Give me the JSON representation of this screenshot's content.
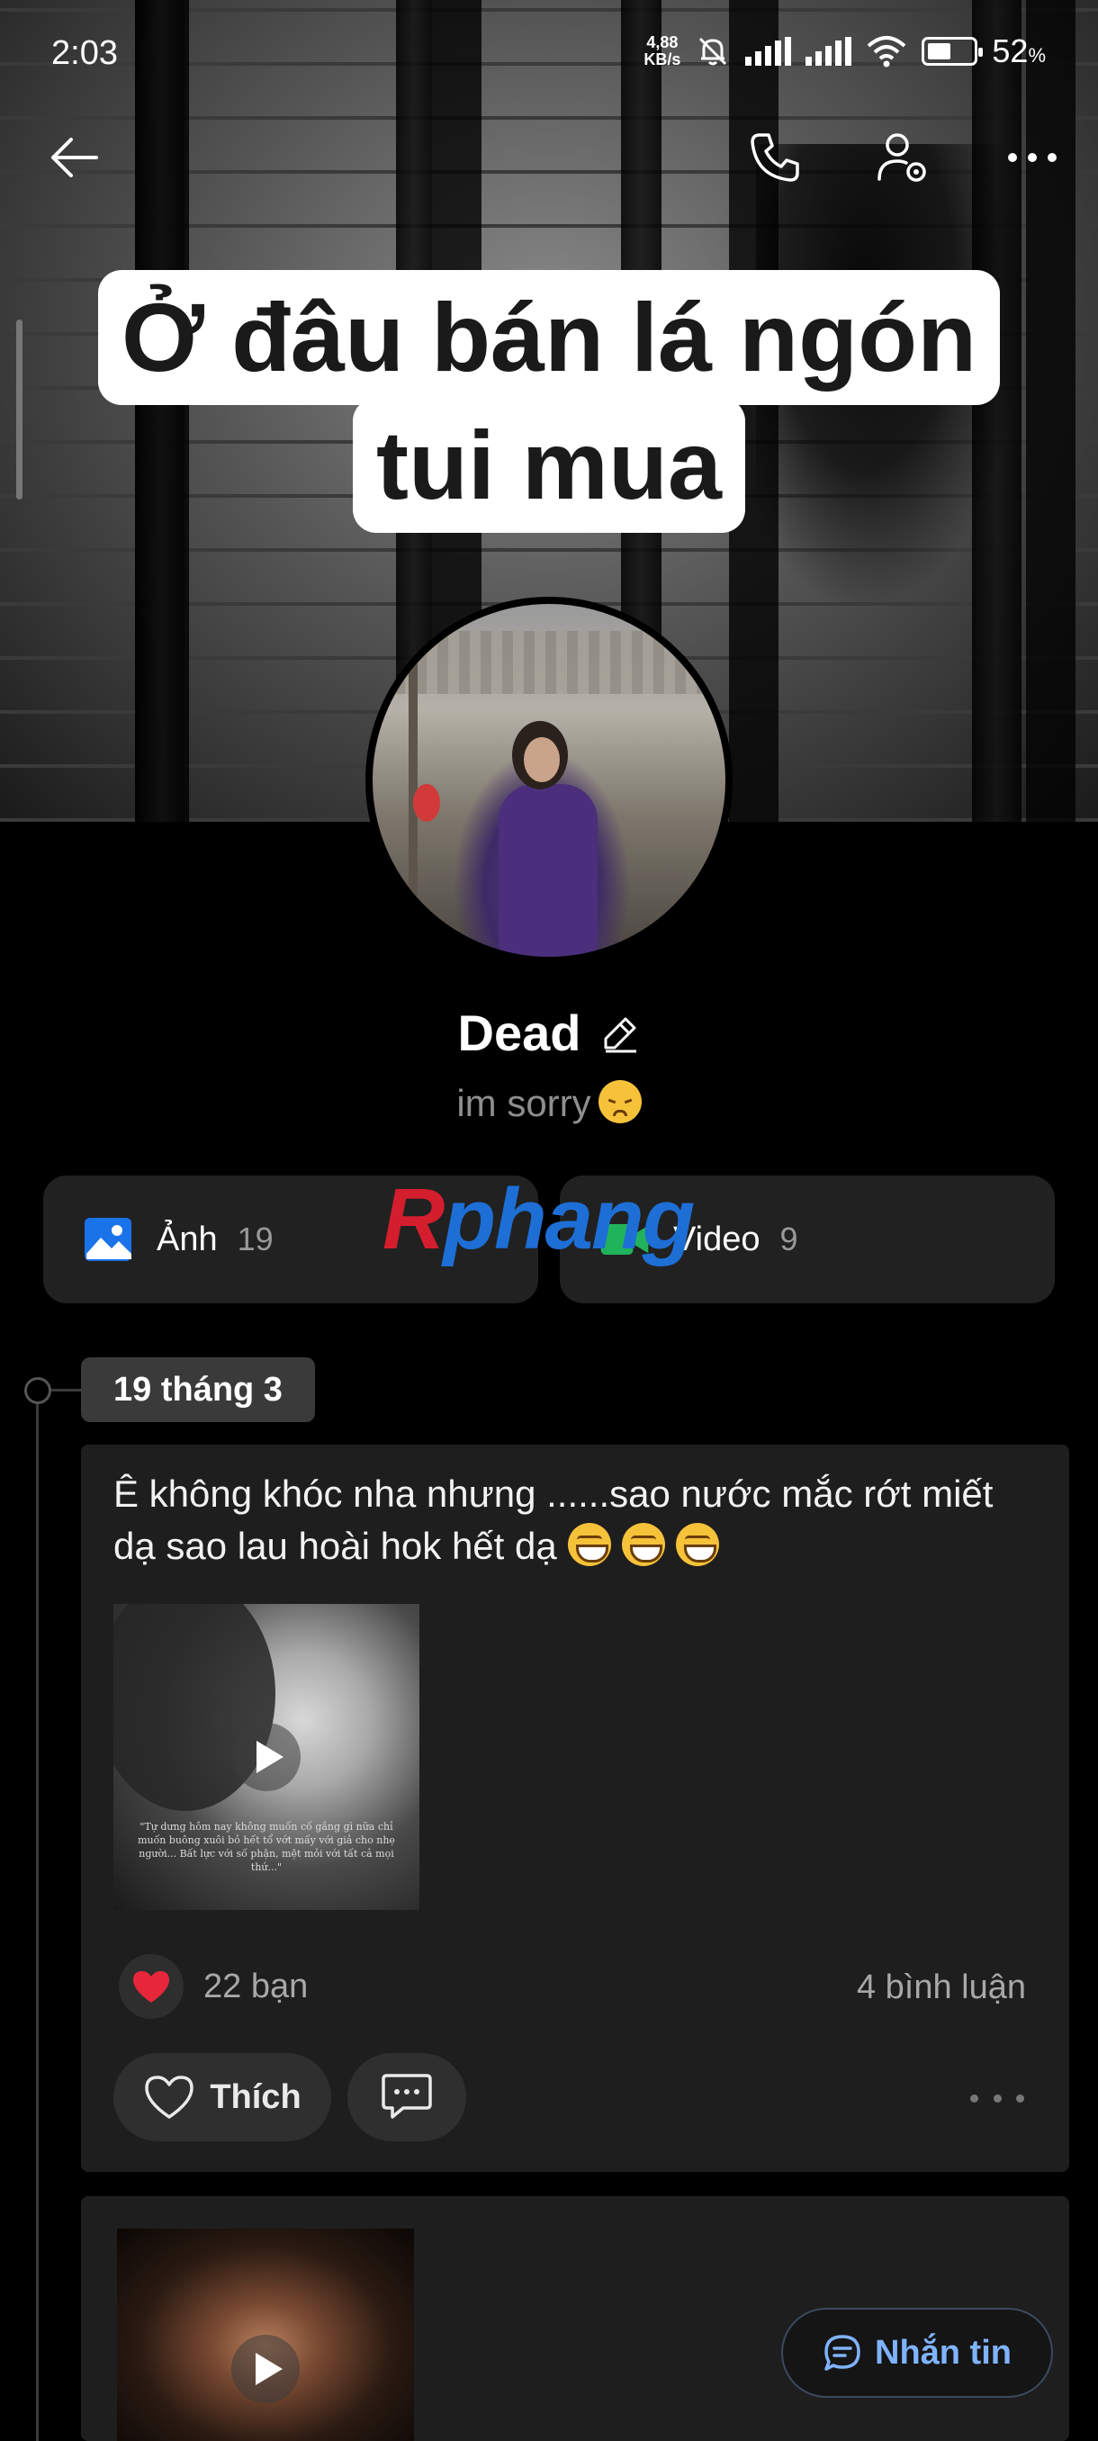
{
  "status_bar": {
    "time": "2:03",
    "net_speed_value": "4,88",
    "net_speed_unit": "KB/s",
    "battery_percent": "52",
    "battery_unit": "%",
    "battery_level": 0.52,
    "icons": [
      "mute-bell-icon",
      "signal-icon",
      "signal-icon",
      "wifi-icon",
      "battery-icon"
    ]
  },
  "nav": {
    "icons": [
      "back-arrow-icon",
      "phone-icon",
      "user-settings-icon",
      "more-icon"
    ]
  },
  "cover": {
    "caption_line1": "Ở đâu bán lá ngón",
    "caption_line2": "tui mua"
  },
  "profile": {
    "name": "Dead",
    "bio": "im sorry",
    "bio_emoji": "disappointed-face"
  },
  "media": {
    "photos_label": "Ảnh",
    "photos_count": "19",
    "videos_label": "Video",
    "videos_count": "9"
  },
  "watermark": {
    "part1": "R",
    "part2": "phang"
  },
  "timeline": {
    "date": "19 tháng 3"
  },
  "post": {
    "text": "Ê không khóc nha nhưng ......sao nước mắc rớt miết dạ sao lau hoài hok hết dạ",
    "emojis": [
      "grinning-face",
      "grinning-face",
      "grinning-face"
    ],
    "video_caption": "\"Tự dưng hôm nay không muốn cố gắng gì nữa chỉ muốn buông xuôi bỏ hết tổ vớt mấy với giả cho nhẹ người... Bất lực với số phận, mệt mỏi với tất cả mọi thứ...\"",
    "reactions_count": "22 bạn",
    "comments_count": "4 bình luận",
    "like_label": "Thích"
  },
  "message_button": {
    "label": "Nhắn tin"
  },
  "colors": {
    "background": "#000000",
    "card": "#1e1e1e",
    "chip": "#3a3a3a",
    "accent_blue": "#7fb3ff",
    "heart_red": "#e8263a",
    "photo_icon_blue": "#1a73e8",
    "video_icon_green": "#21b35b"
  }
}
